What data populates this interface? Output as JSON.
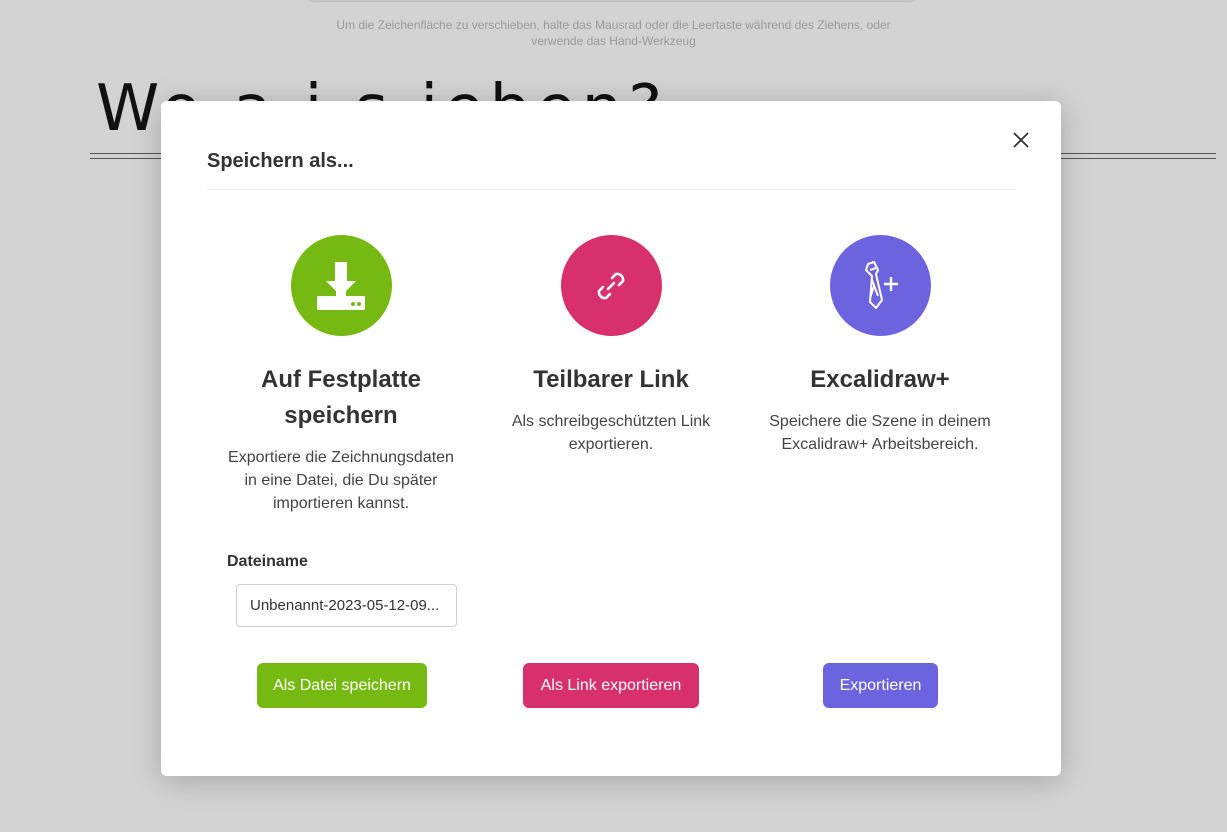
{
  "background": {
    "hint_line1": "Um die Zeichenfläche zu verschieben, halte das Mausrad oder die Leertaste während des Ziehens, oder",
    "hint_line2": "verwende das Hand-Werkzeug",
    "canvas_text": "Wo        a          i   s         ieben?"
  },
  "dialog": {
    "title": "Speichern als...",
    "close_icon": "close-icon",
    "options": [
      {
        "icon": "download-icon",
        "color": "#76b912",
        "title_line1": "Auf Festplatte",
        "title_line2": "speichern",
        "description": "Exportiere die Zeichnungsdaten in eine Datei, die Du später importieren kannst.",
        "filename_label": "Dateiname",
        "filename_value": "Unbenannt-2023-05-12-09...",
        "button_label": "Als Datei speichern"
      },
      {
        "icon": "link-icon",
        "color": "#d8306a",
        "title": "Teilbarer Link",
        "description": "Als schreibgeschützten Link exportieren.",
        "button_label": "Als Link exportieren"
      },
      {
        "icon": "excalidraw-plus-icon",
        "color": "#6c63df",
        "title": "Excalidraw+",
        "description": "Speichere die Szene in deinem Excalidraw+ Arbeitsbereich.",
        "button_label": "Exportieren"
      }
    ]
  }
}
